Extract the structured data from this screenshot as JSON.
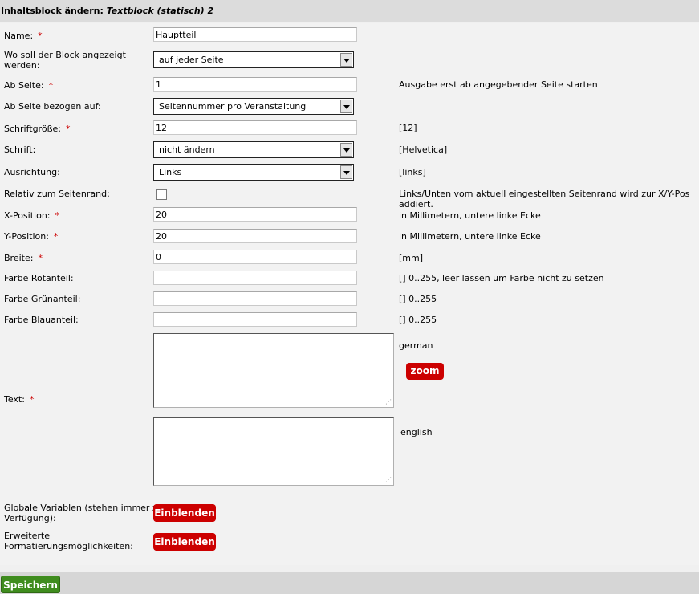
{
  "header": {
    "title_prefix": "Inhaltsblock ändern: ",
    "title_subtitle": "Textblock (statisch) 2"
  },
  "required_mark": "*",
  "fields": {
    "name": {
      "label": "Name:",
      "value": "Hauptteil"
    },
    "location": {
      "label_line1": "Wo soll der Block angezeigt",
      "label_line2": "werden:",
      "value": "auf jeder Seite"
    },
    "from_page": {
      "label": "Ab Seite:",
      "value": "1",
      "hint": "Ausgabe erst ab angegebender Seite starten"
    },
    "from_page_ref": {
      "label": "Ab Seite bezogen auf:",
      "value": "Seitennummer pro Veranstaltung"
    },
    "font_size": {
      "label": "Schriftgröße:",
      "value": "12",
      "hint": "[12]"
    },
    "font": {
      "label": "Schrift:",
      "value": "nicht ändern",
      "hint": "[Helvetica]"
    },
    "alignment": {
      "label": "Ausrichtung:",
      "value": "Links",
      "hint": "[links]"
    },
    "relative_margin": {
      "label": "Relativ zum Seitenrand:",
      "checked": false,
      "hint": "Links/Unten vom aktuell eingestellten Seitenrand wird zur X/Y-Pos addiert."
    },
    "x_pos": {
      "label": "X-Position:",
      "value": "20",
      "hint": "in Millimetern, untere linke Ecke"
    },
    "y_pos": {
      "label": "Y-Position:",
      "value": "20",
      "hint": "in Millimetern, untere linke Ecke"
    },
    "width": {
      "label": "Breite:",
      "value": "0",
      "hint": "[mm]"
    },
    "red": {
      "label": "Farbe Rotanteil:",
      "value": "",
      "hint": "[] 0..255, leer lassen um Farbe nicht zu setzen"
    },
    "green": {
      "label": "Farbe Grünanteil:",
      "value": "",
      "hint": "[] 0..255"
    },
    "blue": {
      "label": "Farbe Blauanteil:",
      "value": "",
      "hint": "[] 0..255"
    },
    "text": {
      "label": "Text:",
      "lang_german": "german",
      "lang_english": "english",
      "zoom_label": "zoom"
    }
  },
  "globals": {
    "label_line1": "Globale Variablen (stehen immer zur",
    "label_line2": "Verfügung):",
    "button": "Einblenden"
  },
  "formatting": {
    "label_line1": "Erweiterte",
    "label_line2": "Formatierungsmöglichkeiten:",
    "button": "Einblenden"
  },
  "footer": {
    "save_label": "Speichern"
  },
  "colors": {
    "required": "#cc0000",
    "red_button": "#cc0000",
    "save_button": "#3f8c1e"
  }
}
